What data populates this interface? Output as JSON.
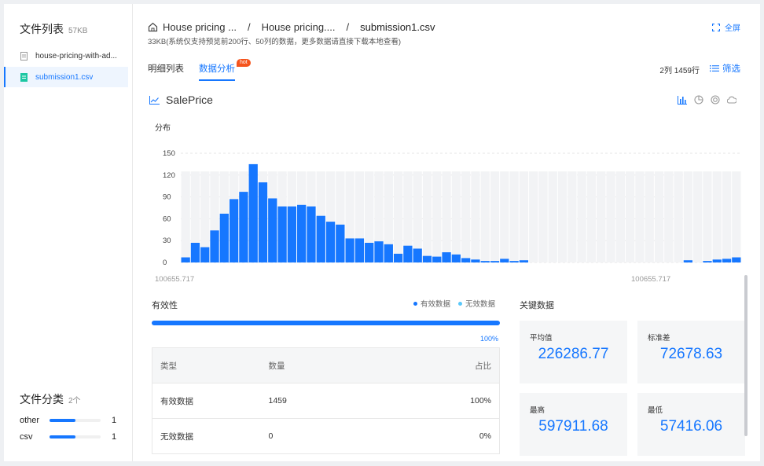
{
  "sidebar": {
    "title": "文件列表",
    "size": "57KB",
    "files": [
      {
        "name": "house-pricing-with-ad...",
        "icon": "file-icon"
      },
      {
        "name": "submission1.csv",
        "icon": "csv-file-icon"
      }
    ],
    "category_title": "文件分类",
    "category_count": "2个",
    "categories": [
      {
        "label": "other",
        "count": "1",
        "fraction": 0.5
      },
      {
        "label": "csv",
        "count": "1",
        "fraction": 0.5
      }
    ]
  },
  "header": {
    "breadcrumb": [
      "House pricing ...",
      "House pricing....",
      "submission1.csv"
    ],
    "separator": "/",
    "subtitle": "33KB(系统仅支持预览前200行、50列的数据，更多数据请直接下载本地查看)",
    "fullscreen": "全屏"
  },
  "tabs": [
    {
      "label": "明细列表",
      "active": false
    },
    {
      "label": "数据分析",
      "active": true,
      "badge": "hot"
    }
  ],
  "row_count": "2列 1459行",
  "filter_label": "筛选",
  "column": {
    "name": "SalePrice",
    "dist_label": "分布",
    "x_min_label": "100655.717",
    "x_max_label": "100655.717"
  },
  "chart_data": {
    "type": "bar",
    "title": "",
    "ylim": [
      0,
      150
    ],
    "yticks": [
      0,
      30,
      60,
      90,
      120,
      150
    ],
    "values": [
      7,
      27,
      21,
      44,
      67,
      87,
      97,
      135,
      110,
      88,
      77,
      77,
      79,
      77,
      64,
      56,
      52,
      33,
      33,
      27,
      29,
      25,
      12,
      23,
      19,
      9,
      8,
      14,
      11,
      6,
      4,
      2,
      2,
      5,
      2,
      3,
      0,
      0,
      0,
      0,
      0,
      0,
      0,
      0,
      0,
      0,
      0,
      0,
      0,
      0,
      0,
      0,
      0,
      0,
      0,
      0,
      0,
      0,
      0,
      0,
      0,
      0,
      0,
      0,
      0,
      0,
      0,
      0,
      0,
      0,
      0,
      0,
      0,
      0,
      0,
      0,
      0,
      0,
      0,
      0,
      0,
      0,
      0,
      0,
      0,
      0,
      0,
      0,
      0,
      0,
      0,
      0,
      0,
      0,
      0,
      0,
      0,
      0,
      0,
      0
    ],
    "tail_values": [
      3,
      0,
      2,
      4,
      5,
      7
    ],
    "bar_color": "#1677ff",
    "background_color": "#f2f3f5",
    "grid": true
  },
  "validity": {
    "title": "有效性",
    "legend_valid": "有效数据",
    "legend_invalid": "无效数据",
    "valid_color": "#1677ff",
    "invalid_color": "#5ac8fa",
    "percent": "100%",
    "fraction": 1.0,
    "headers": [
      "类型",
      "数量",
      "占比"
    ],
    "rows": [
      [
        "有效数据",
        "1459",
        "100%"
      ],
      [
        "无效数据",
        "0",
        "0%"
      ]
    ]
  },
  "key_stats": {
    "title": "关键数据",
    "cards": [
      {
        "label": "平均值",
        "value": "226286.77"
      },
      {
        "label": "标准差",
        "value": "72678.63"
      },
      {
        "label": "最高",
        "value": "597911.68"
      },
      {
        "label": "最低",
        "value": "57416.06"
      }
    ]
  }
}
